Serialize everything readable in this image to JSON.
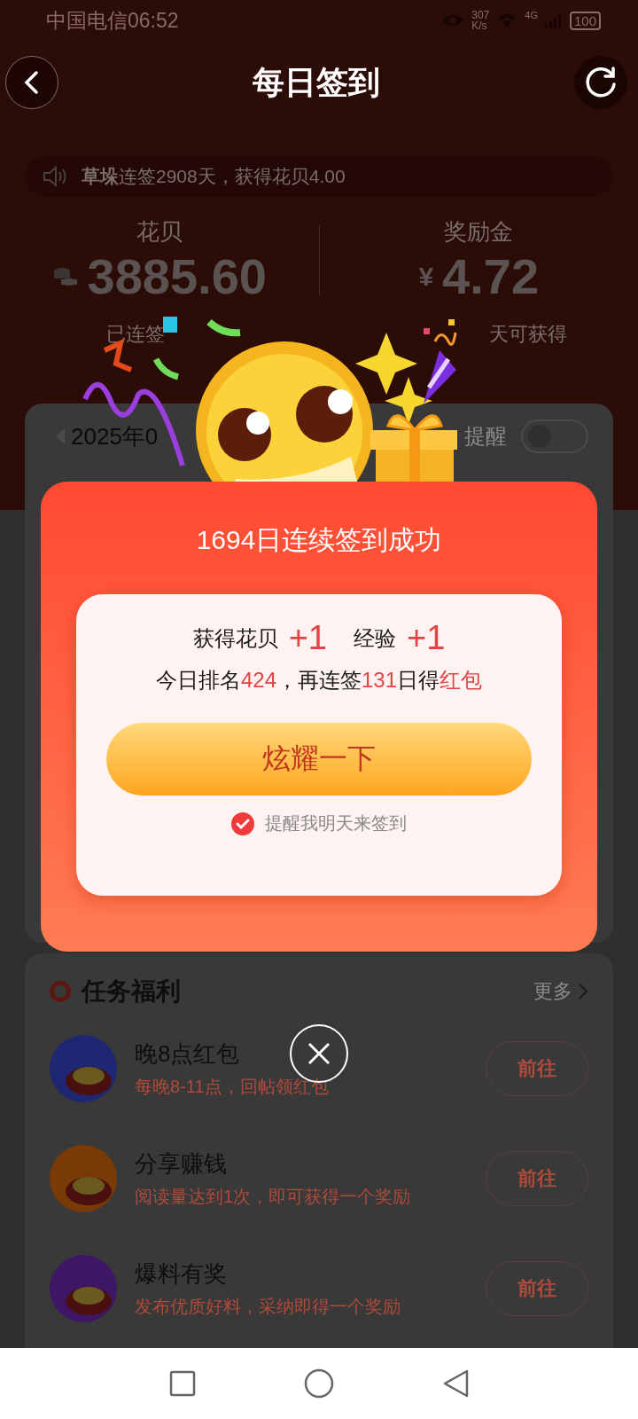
{
  "status_bar": {
    "carrier_time": "中国电信06:52",
    "speed": "307",
    "speed_unit": "K/s",
    "network": "4G",
    "battery": "100"
  },
  "header": {
    "title": "每日签到"
  },
  "ticker": {
    "name": "草垛",
    "message": "连签2908天，获得花贝4.00"
  },
  "stats": [
    {
      "label": "花贝",
      "kind": "coins",
      "value": "3885.60"
    },
    {
      "label": "奖励金",
      "kind": "currency",
      "symbol": "¥",
      "value": "4.72"
    }
  ],
  "streak": {
    "left": "已连签",
    "right": "天可获得"
  },
  "calendar": {
    "month": "2025年0",
    "reminder_label": "提醒",
    "reminder_on": false
  },
  "dialog": {
    "title": "1694日连续签到成功",
    "rewards": [
      {
        "label": "获得花贝",
        "amount": "+1"
      },
      {
        "label": "经验",
        "amount": "+1"
      }
    ],
    "rank": [
      {
        "text": "今日排名",
        "highlight": false
      },
      {
        "text": "424",
        "highlight": true
      },
      {
        "text": "，再连签",
        "highlight": false
      },
      {
        "text": "131",
        "highlight": true
      },
      {
        "text": "日得",
        "highlight": false
      },
      {
        "text": "红包",
        "highlight": true
      }
    ],
    "button": "炫耀一下",
    "remind": {
      "label": "提醒我明天来签到",
      "checked": true
    }
  },
  "tasks": {
    "title": "任务福利",
    "more": "更多",
    "items": [
      {
        "title": "晚8点红包",
        "desc": "每晚8-11点，回帖领红包",
        "button": "前往",
        "color": "#1f2672"
      },
      {
        "title": "分享赚钱",
        "desc": "阅读量达到1次，即可获得一个奖励",
        "button": "前往",
        "color": "#7a3a06"
      },
      {
        "title": "爆料有奖",
        "desc": "发布优质好料，采纳即得一个奖励",
        "button": "前往",
        "color": "#3d1766"
      }
    ]
  }
}
